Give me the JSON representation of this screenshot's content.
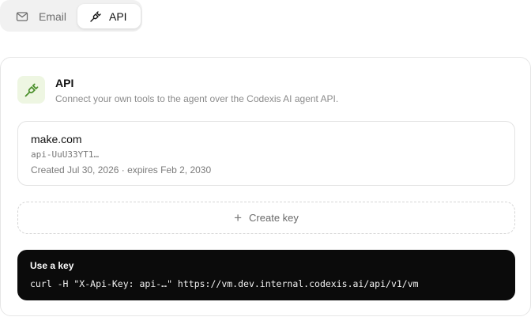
{
  "tabs": [
    {
      "label": "Email",
      "icon": "mail-icon"
    },
    {
      "label": "API",
      "icon": "plug-icon",
      "active": true
    }
  ],
  "api_section": {
    "icon": "plug-icon",
    "icon_color": "#4a8f2a",
    "title": "API",
    "description": "Connect your own tools to the agent over the Codexis AI agent API."
  },
  "keys": [
    {
      "name": "make.com",
      "prefix": "api-UuU33YT1…",
      "meta": "Created Jul 30, 2026 · expires Feb 2, 2030"
    }
  ],
  "create_key": {
    "label": "Create key",
    "icon": "plus-icon"
  },
  "usage": {
    "title": "Use a key",
    "command": "curl -H \"X-Api-Key: api-…\" https://vm.dev.internal.codexis.ai/api/v1/vm"
  }
}
